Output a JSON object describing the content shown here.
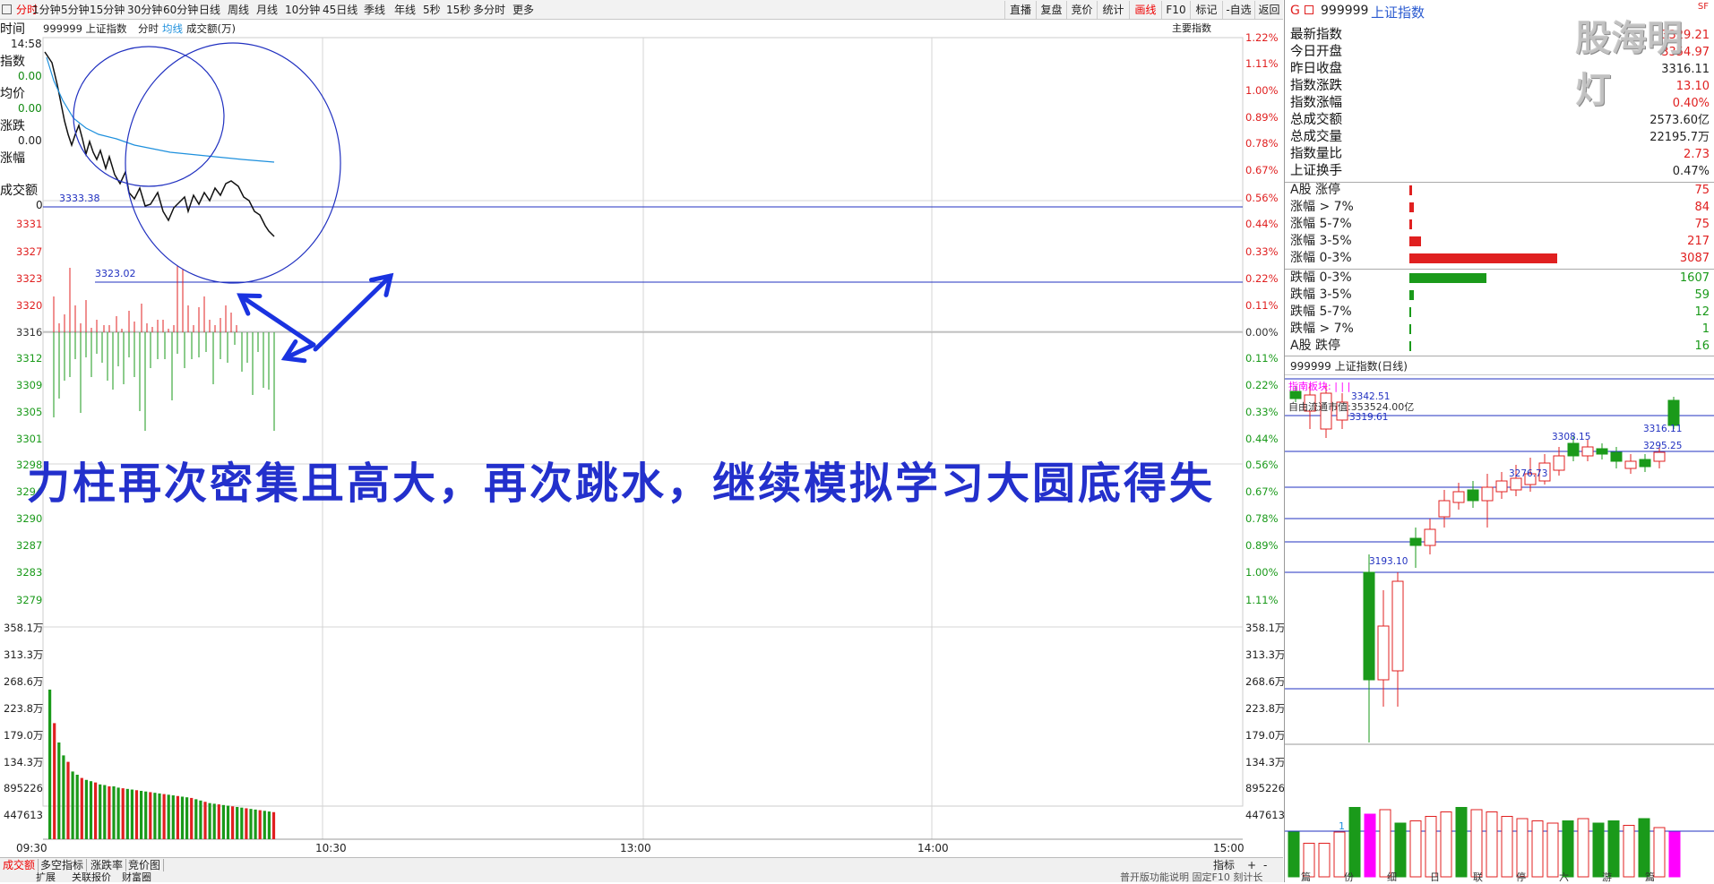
{
  "toolbar": {
    "left_items": [
      "分时",
      "1分钟",
      "5分钟",
      "15分钟",
      "30分钟",
      "60分钟",
      "日线",
      "周线",
      "月线",
      "10分钟",
      "45日线",
      "季线",
      "年线",
      "5秒",
      "15秒",
      "多分时",
      "更多"
    ],
    "right_items": [
      "直播",
      "复盘",
      "竞价",
      "统计",
      "画线",
      "F10",
      "标记",
      "-自选",
      "返回"
    ]
  },
  "subheader": {
    "code_name": "999999 上证指数",
    "mode": "分时",
    "avg_line": "均线",
    "volume": "成交额(万)",
    "main_indicator": "主要指数"
  },
  "left_info": {
    "time_label": "时间",
    "time_value": "14:58",
    "index_label": "指数",
    "index_value": "0.00",
    "avg_label": "均价",
    "avg_value": "0.00",
    "change_label": "涨跌",
    "change_value": "0.00",
    "pct_label": "涨幅",
    "amount_label": "成交额",
    "amount_value": "0"
  },
  "price_axis": [
    "3331",
    "3327",
    "3323",
    "3320",
    "3316",
    "3312",
    "3309",
    "3305",
    "3301",
    "3298",
    "3294",
    "3290",
    "3287",
    "3283",
    "3279"
  ],
  "pct_axis": [
    "1.22%",
    "1.11%",
    "1.00%",
    "0.89%",
    "0.78%",
    "0.67%",
    "0.56%",
    "0.44%",
    "0.33%",
    "0.22%",
    "0.11%",
    "0.00%",
    "0.11%",
    "0.22%",
    "0.33%",
    "0.44%",
    "0.56%",
    "0.67%",
    "0.78%",
    "0.89%",
    "1.00%",
    "1.11%"
  ],
  "volume_axis": [
    "358.1万",
    "313.3万",
    "268.6万",
    "223.8万",
    "179.0万",
    "134.3万",
    "895226",
    "447613"
  ],
  "time_axis": [
    "09:30",
    "10:30",
    "13:00",
    "14:00",
    "15:00"
  ],
  "price_marks": {
    "hline1": "3333.38",
    "hline2": "3323.02"
  },
  "annotation": "力柱再次密集且高大，再次跳水，继续模拟学习大圆底得失",
  "watermark": "股海明灯",
  "bottom_tabs": [
    "成交额",
    "多空指标",
    "涨跌率",
    "竞价图"
  ],
  "bottom_right": [
    "指标",
    "+",
    "-"
  ],
  "bottom_sub": [
    "扩展",
    "关联报价",
    "财富圈"
  ],
  "bottom_status": "普开版功能说明 固定F10 刻计长",
  "right_panel": {
    "header_mark": "G",
    "header_code": "999999",
    "header_name": "上证指数",
    "header_badge": "SF",
    "quotes": [
      {
        "k": "最新指数",
        "v": "3329.21",
        "c": "up"
      },
      {
        "k": "今日开盘",
        "v": "3354.97",
        "c": "up"
      },
      {
        "k": "昨日收盘",
        "v": "3316.11",
        "c": "n"
      },
      {
        "k": "指数涨跌",
        "v": "13.10",
        "c": "up"
      },
      {
        "k": "指数涨幅",
        "v": "0.40%",
        "c": "up"
      },
      {
        "k": "总成交额",
        "v": "2573.60亿",
        "c": "n"
      },
      {
        "k": "总成交量",
        "v": "22195.7万",
        "c": "n"
      },
      {
        "k": "指数量比",
        "v": "2.73",
        "c": "up"
      },
      {
        "k": "上证换手",
        "v": "0.47%",
        "c": "n"
      }
    ],
    "breadth_up": [
      {
        "k": "A股 涨停",
        "v": "75",
        "w": 2
      },
      {
        "k": "涨幅 > 7%",
        "v": "84",
        "w": 3
      },
      {
        "k": "涨幅 5-7%",
        "v": "75",
        "w": 2
      },
      {
        "k": "涨幅 3-5%",
        "v": "217",
        "w": 8
      },
      {
        "k": "涨幅 0-3%",
        "v": "3087",
        "w": 100
      }
    ],
    "breadth_down": [
      {
        "k": "跌幅 0-3%",
        "v": "1607",
        "w": 52
      },
      {
        "k": "跌幅 3-5%",
        "v": "59",
        "w": 3
      },
      {
        "k": "跌幅 5-7%",
        "v": "12",
        "w": 1
      },
      {
        "k": "跌幅 > 7%",
        "v": "1",
        "w": 1
      },
      {
        "k": "A股 跌停",
        "v": "16",
        "w": 1
      }
    ],
    "kline_title": "999999 上证指数(日线)",
    "kline_legend": "指南板块: | | |",
    "kline_float": "自由流通市值:353524.00亿",
    "kline_labels": {
      "l1": "3342.51",
      "l2": "3319.61",
      "l3": "3308.15",
      "l4": "3276.73",
      "l5": "3316.11",
      "l6": "3295.25",
      "l7": "3193.10"
    },
    "kline_bottom_label": "1",
    "kline_xaxis": [
      "篇",
      "份",
      "细",
      "日",
      "联",
      "停",
      "六",
      "游",
      "篇"
    ]
  },
  "colors": {
    "up": "#e02020",
    "down": "#1a9a1a",
    "price_line": "#111111",
    "avg_line": "#1e90dd",
    "annotation": "#2330cc",
    "hline": "#2030c0",
    "magenta": "#ff00ff"
  }
}
